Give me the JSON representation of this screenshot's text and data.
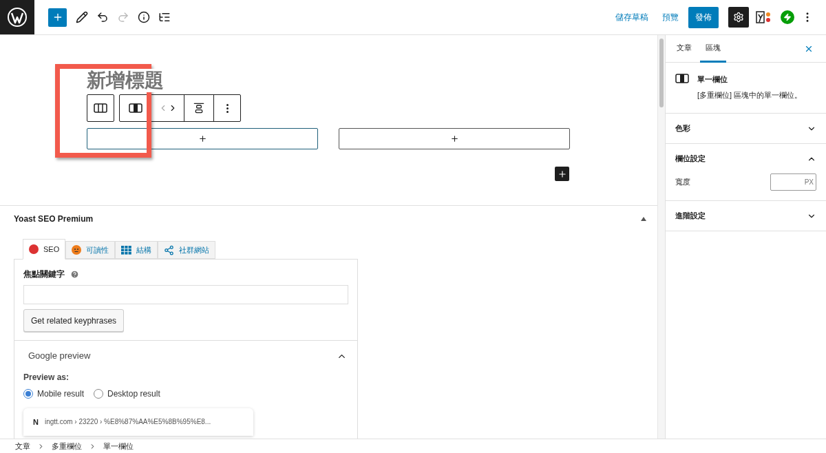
{
  "topbar": {
    "save_draft": "儲存草稿",
    "preview": "預覽",
    "publish": "發佈"
  },
  "editor": {
    "title_placeholder": "新增標題",
    "columns": [
      {
        "selected": true
      },
      {
        "selected": false
      }
    ]
  },
  "yoast": {
    "title": "Yoast SEO Premium",
    "tabs": [
      {
        "label": "SEO",
        "kind": "dot",
        "selected": true
      },
      {
        "label": "可讀性",
        "kind": "face",
        "selected": false
      },
      {
        "label": "結構",
        "kind": "grid",
        "selected": false
      },
      {
        "label": "社群網站",
        "kind": "share",
        "selected": false
      }
    ],
    "focus_label": "焦點關鍵字",
    "related_button": "Get related keyphrases",
    "preview_heading": "Google preview",
    "preview_expanded": true,
    "preview_as": "Preview as:",
    "radios": [
      {
        "label": "Mobile result",
        "selected": true
      },
      {
        "label": "Desktop result",
        "selected": false
      }
    ],
    "favicon": "N",
    "snippet_url": "ingtt.com › 23220 › %E8%87%AA%E5%8B%95%E8..."
  },
  "sidebar": {
    "tabs": [
      {
        "label": "文章",
        "selected": false
      },
      {
        "label": "區塊",
        "selected": true
      }
    ],
    "block_title": "單一欄位",
    "block_description": "[多重欄位] 區塊中的單一欄位。",
    "panels": [
      {
        "title": "色彩",
        "expanded": false
      },
      {
        "title": "欄位設定",
        "expanded": true,
        "field_label": "寬度",
        "field_unit": "PX"
      },
      {
        "title": "進階設定",
        "expanded": false
      }
    ]
  },
  "breadcrumb": [
    "文章",
    "多重欄位",
    "單一欄位"
  ]
}
